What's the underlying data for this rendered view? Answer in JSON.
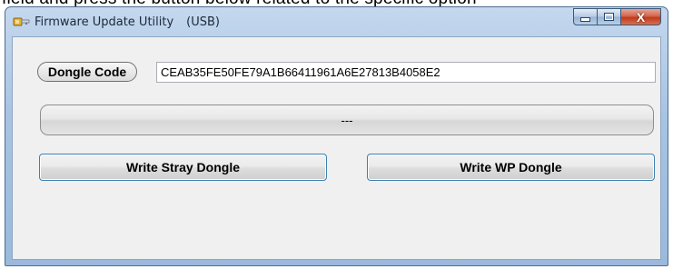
{
  "caption": "field and press the button below related to the specific option",
  "window": {
    "title": "Firmware Update Utility",
    "connection": "(USB)",
    "controls": {
      "minimize": "minimize",
      "maximize": "maximize",
      "close": "X"
    }
  },
  "dongle": {
    "label": "Dongle Code",
    "code": "CEAB35FE50FE79A1B66411961A6E27813B4058E2"
  },
  "status": {
    "text": "---"
  },
  "buttons": {
    "write_stray": "Write Stray Dongle",
    "write_wp": "Write WP Dongle"
  },
  "colors": {
    "frame": "#a9c4e3",
    "close": "#c2391c",
    "button_border": "#3c7fb1"
  }
}
